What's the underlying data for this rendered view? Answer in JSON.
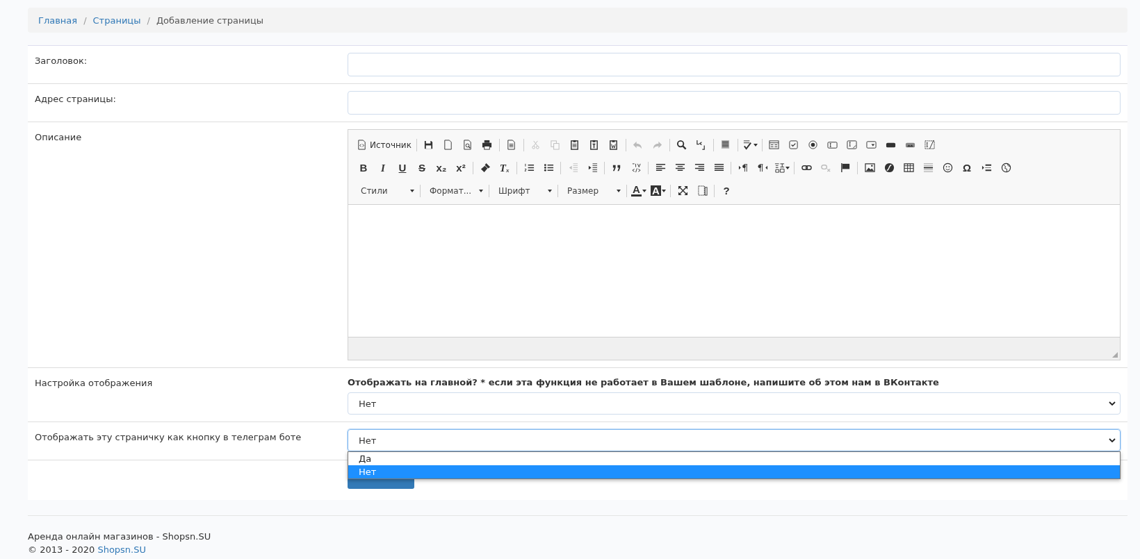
{
  "breadcrumb": [
    {
      "label": "Главная",
      "link": true
    },
    {
      "separator": "/",
      "label": "Страницы",
      "link": true
    },
    {
      "separator": "/",
      "label": "Добавление страницы",
      "link": false
    }
  ],
  "fields": [
    {
      "kind": "text",
      "label": "Заголовок:"
    },
    {
      "kind": "text",
      "label": "Адрес страницы:"
    },
    {
      "kind": "editor",
      "label": "Описание"
    },
    {
      "kind": "select",
      "label": "Настройка отображения",
      "hint": "Отображать на главной? * если эта функция не работает в Вашем шаблоне, напишите об этом нам в ВКонтакте",
      "value": "Нет",
      "focused": false,
      "expanded": false
    },
    {
      "kind": "select",
      "label": "Отображать эту страничку как кнопку в телеграм боте",
      "value": "Нет",
      "focused": true,
      "expanded": true,
      "options": [
        {
          "label": "Да",
          "selected": false
        },
        {
          "label": "Нет",
          "selected": true
        }
      ]
    }
  ],
  "editor": {
    "toolbar": [
      [
        [
          {
            "kind": "button",
            "label": "Источник",
            "disabled": false
          }
        ],
        [
          {
            "kind": "button",
            "disabled": false
          },
          {
            "kind": "button",
            "disabled": false
          },
          {
            "kind": "button",
            "disabled": false
          },
          {
            "kind": "button",
            "disabled": false
          }
        ],
        [
          {
            "kind": "button",
            "disabled": false
          }
        ],
        [
          {
            "kind": "button",
            "disabled": true
          },
          {
            "kind": "button",
            "disabled": true
          },
          {
            "kind": "button",
            "disabled": false
          },
          {
            "kind": "button",
            "disabled": false
          },
          {
            "kind": "button",
            "disabled": false
          }
        ],
        [
          {
            "kind": "button",
            "disabled": true
          },
          {
            "kind": "button",
            "disabled": true
          }
        ],
        [
          {
            "kind": "button",
            "disabled": false
          },
          {
            "kind": "button",
            "disabled": false
          }
        ],
        [
          {
            "kind": "button",
            "disabled": false
          }
        ],
        [
          {
            "kind": "button",
            "disabled": false,
            "dropdown": true
          }
        ],
        [
          {
            "kind": "button",
            "disabled": false
          },
          {
            "kind": "button",
            "disabled": false
          },
          {
            "kind": "button",
            "disabled": false
          },
          {
            "kind": "button",
            "disabled": false
          },
          {
            "kind": "button",
            "disabled": false
          },
          {
            "kind": "button",
            "disabled": false
          },
          {
            "kind": "button",
            "disabled": false
          },
          {
            "kind": "button",
            "disabled": false
          },
          {
            "kind": "button",
            "disabled": false
          }
        ]
      ],
      [
        [
          {
            "kind": "glyph",
            "text": "B"
          },
          {
            "kind": "glyph",
            "text": "I"
          },
          {
            "kind": "glyph",
            "text": "U"
          },
          {
            "kind": "glyph",
            "text": "S"
          },
          {
            "kind": "glyph",
            "text": "x₂"
          },
          {
            "kind": "glyph",
            "text": "x²"
          }
        ],
        [
          {
            "kind": "button",
            "disabled": false
          },
          {
            "kind": "glyph",
            "text": "Tₓ"
          }
        ],
        [
          {
            "kind": "button",
            "disabled": false
          },
          {
            "kind": "button",
            "disabled": false
          }
        ],
        [
          {
            "kind": "button",
            "disabled": true
          },
          {
            "kind": "button",
            "disabled": false
          }
        ],
        [
          {
            "kind": "button",
            "disabled": false
          },
          {
            "kind": "button",
            "disabled": false
          }
        ],
        [
          {
            "kind": "button",
            "disabled": false
          },
          {
            "kind": "button",
            "disabled": false
          },
          {
            "kind": "button",
            "disabled": false
          },
          {
            "kind": "button",
            "disabled": false
          }
        ],
        [
          {
            "kind": "button",
            "disabled": false
          },
          {
            "kind": "button",
            "disabled": false
          },
          {
            "kind": "button",
            "disabled": false,
            "dropdown": true
          }
        ],
        [
          {
            "kind": "button",
            "disabled": false
          },
          {
            "kind": "button",
            "disabled": true
          },
          {
            "kind": "button",
            "disabled": false
          }
        ],
        [
          {
            "kind": "button",
            "disabled": false
          },
          {
            "kind": "button",
            "disabled": false
          },
          {
            "kind": "button",
            "disabled": false
          },
          {
            "kind": "button",
            "disabled": false
          },
          {
            "kind": "button",
            "disabled": false
          },
          {
            "kind": "glyph",
            "text": "Ω"
          },
          {
            "kind": "button",
            "disabled": false
          },
          {
            "kind": "button",
            "disabled": false
          }
        ]
      ],
      [
        [
          {
            "kind": "combo",
            "label": "Стили"
          }
        ],
        [
          {
            "kind": "combo",
            "label": "Формат..."
          }
        ],
        [
          {
            "kind": "combo",
            "label": "Шрифт"
          }
        ],
        [
          {
            "kind": "combo",
            "label": "Размер"
          }
        ],
        [
          {
            "kind": "glyph",
            "text": "A",
            "dropdown": true
          },
          {
            "kind": "glyph",
            "text": "A",
            "dropdown": true
          }
        ],
        [
          {
            "kind": "button",
            "disabled": false
          },
          {
            "kind": "button",
            "disabled": false
          }
        ],
        [
          {
            "kind": "glyph",
            "text": "?"
          }
        ]
      ]
    ]
  },
  "footer": {
    "line": "Аренда онлайн магазинов - Shopsn.SU",
    "copyright": "© 2013 - 2020 ",
    "link": "Shopsn.SU"
  }
}
